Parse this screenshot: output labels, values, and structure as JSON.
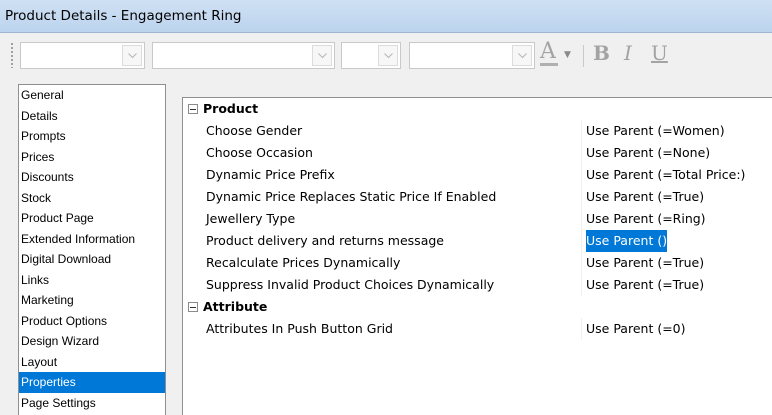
{
  "window": {
    "title": "Product Details - Engagement Ring"
  },
  "toolbar": {
    "font_color_letter": "A",
    "bold_label": "B",
    "italic_label": "I",
    "underline_label": "U"
  },
  "sidebar": {
    "items": [
      {
        "label": "General"
      },
      {
        "label": "Details"
      },
      {
        "label": "Prompts"
      },
      {
        "label": "Prices"
      },
      {
        "label": "Discounts"
      },
      {
        "label": "Stock"
      },
      {
        "label": "Product Page"
      },
      {
        "label": "Extended Information"
      },
      {
        "label": "Digital Download"
      },
      {
        "label": "Links"
      },
      {
        "label": "Marketing"
      },
      {
        "label": "Product Options"
      },
      {
        "label": "Design Wizard"
      },
      {
        "label": "Layout"
      },
      {
        "label": "Properties",
        "selected": true
      },
      {
        "label": "Page Settings"
      }
    ]
  },
  "properties": {
    "product": {
      "label": "Product",
      "rows": [
        {
          "name": "Choose Gender",
          "value": "Use Parent (=Women)"
        },
        {
          "name": "Choose Occasion",
          "value": "Use Parent (=None)"
        },
        {
          "name": "Dynamic Price Prefix",
          "value": "Use Parent (=Total Price:)"
        },
        {
          "name": "Dynamic Price Replaces Static Price If Enabled",
          "value": "Use Parent (=True)"
        },
        {
          "name": "Jewellery Type",
          "value": "Use Parent (=Ring)"
        },
        {
          "name": "Product delivery and returns message",
          "value": "Use Parent ()",
          "selected": true
        },
        {
          "name": "Recalculate Prices Dynamically",
          "value": "Use Parent (=True)"
        },
        {
          "name": "Suppress Invalid Product Choices Dynamically",
          "value": "Use Parent (=True)"
        }
      ]
    },
    "attribute": {
      "label": "Attribute",
      "rows": [
        {
          "name": "Attributes In Push Button Grid",
          "value": "Use Parent (=0)"
        }
      ]
    }
  }
}
